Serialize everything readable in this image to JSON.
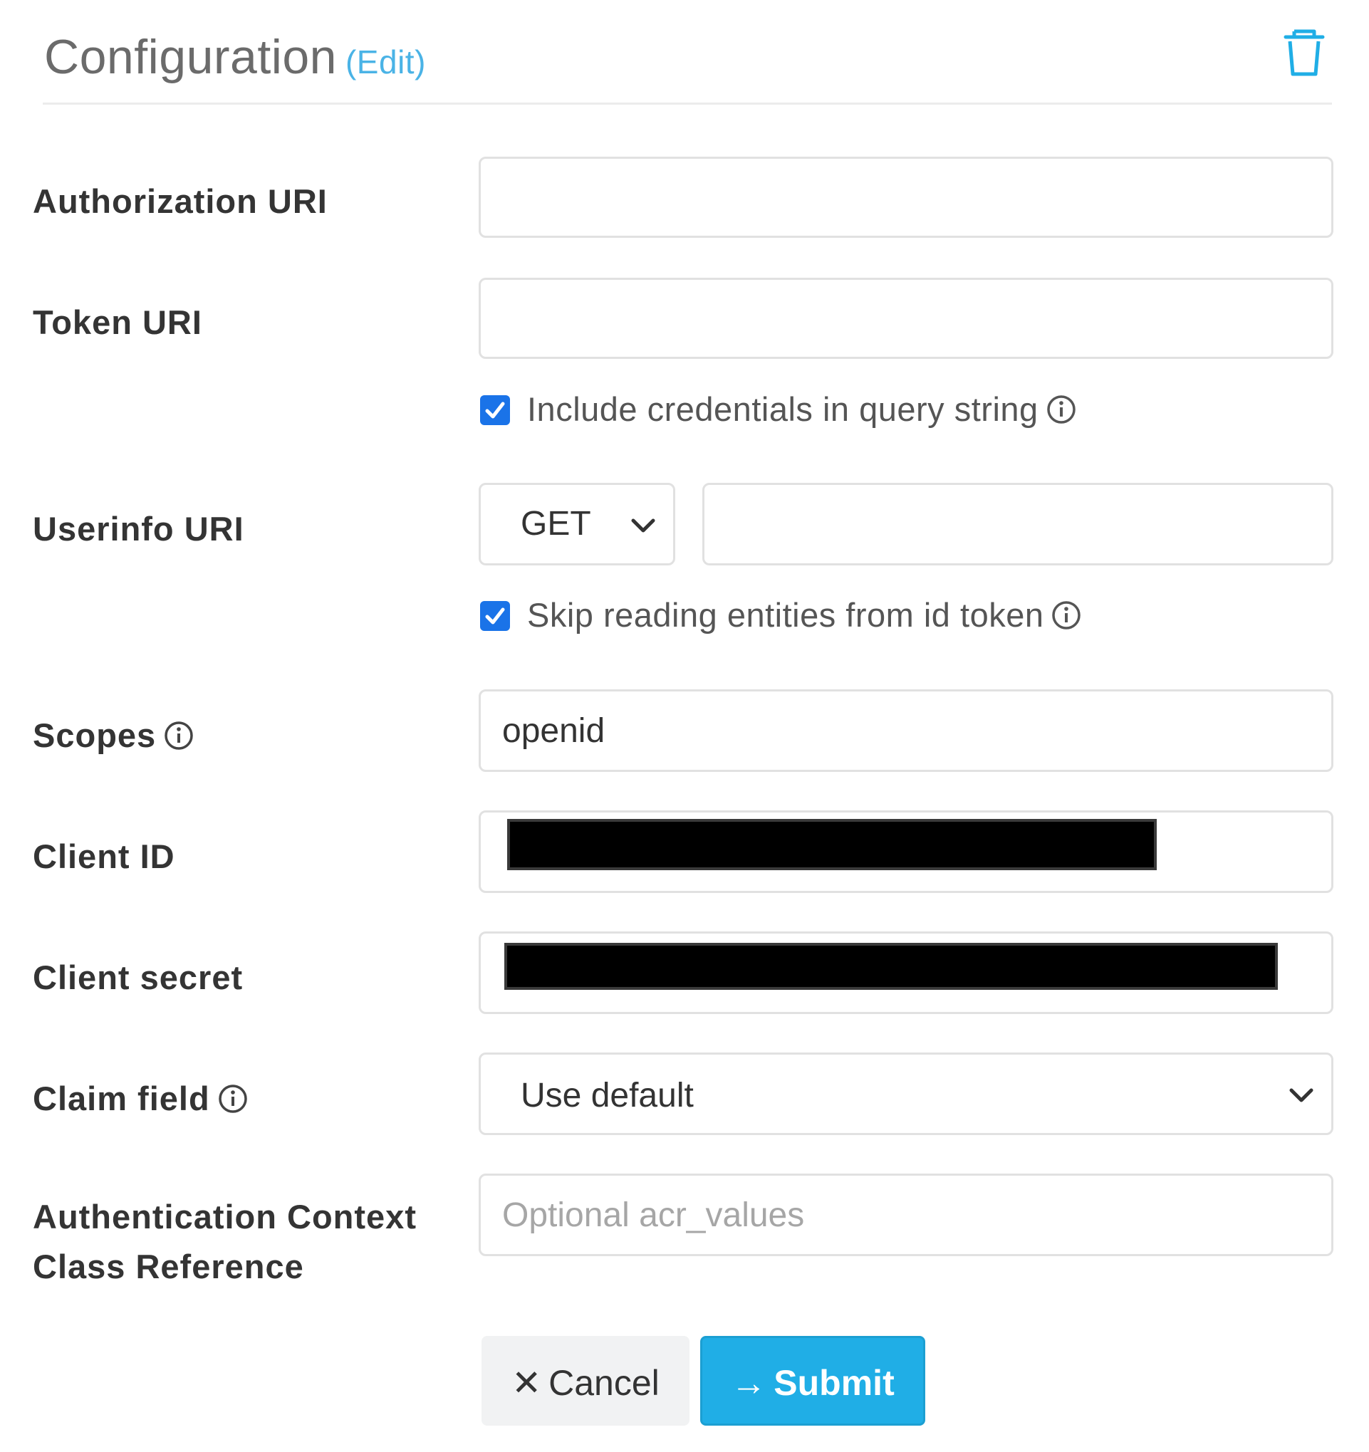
{
  "header": {
    "title": "Configuration",
    "edit_link": "(Edit)",
    "delete_icon": "trash-icon"
  },
  "fields": {
    "authorization_uri": {
      "label": "Authorization URI",
      "value": ""
    },
    "token_uri": {
      "label": "Token URI",
      "value": ""
    },
    "include_credentials": {
      "label": "Include credentials in query string",
      "checked": true
    },
    "userinfo_uri": {
      "label": "Userinfo URI",
      "method": "GET",
      "value": ""
    },
    "skip_reading": {
      "label": "Skip reading entities from id token",
      "checked": true
    },
    "scopes": {
      "label": "Scopes",
      "value": "openid"
    },
    "client_id": {
      "label": "Client ID"
    },
    "client_secret": {
      "label": "Client secret"
    },
    "claim_field": {
      "label": "Claim field",
      "value": "Use default"
    },
    "acr": {
      "label_line1": "Authentication Context",
      "label_line2": "Class Reference",
      "placeholder": "Optional acr_values",
      "value": ""
    }
  },
  "actions": {
    "cancel_glyph": "✕",
    "cancel_label": "Cancel",
    "submit_glyph": "→",
    "submit_label": "Submit"
  },
  "colors": {
    "accent": "#20aee6",
    "edit_link": "#4ab3e6",
    "checkbox": "#1a73e8"
  }
}
